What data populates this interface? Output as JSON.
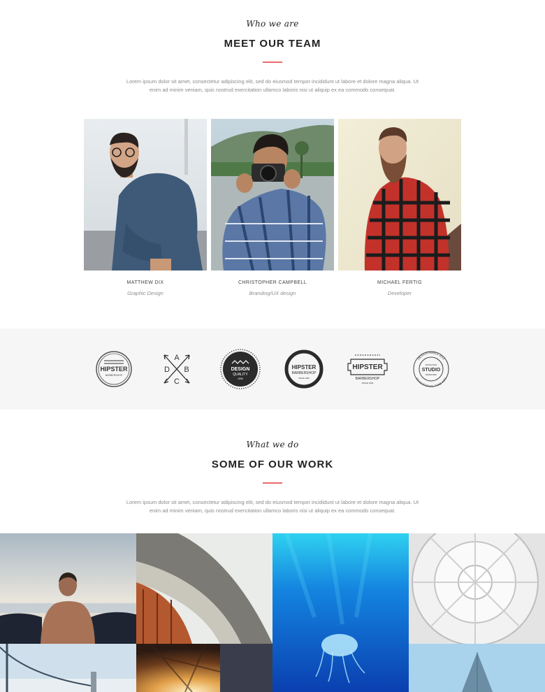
{
  "team": {
    "subtitle": "Who we are",
    "title": "MEET OUR TEAM",
    "text": "Lorem ipsum dolor sit amet, consectetur adipiscing elit, sed do eiusmod tempor incididunt ut labore et dolore magna aliqua. Ut enim ad minim veniam, quis nostrud exercitation ullamco laboris nisi ut aliquip ex ea commodo consequat.",
    "members": [
      {
        "name": "MATTHEW DIX",
        "role": "Graphic Design"
      },
      {
        "name": "CHRISTOPHER CAMPBELL",
        "role": "Branding/UX design"
      },
      {
        "name": "MICHAEL FERTIG",
        "role": "Developer"
      }
    ]
  },
  "logos": {
    "items": [
      {
        "icon": "hipster-barbershop-badge",
        "line1": "HIPSTER",
        "line2": "BARBERSHOP"
      },
      {
        "icon": "crossed-arrows-abcd",
        "a": "A",
        "b": "B",
        "c": "C",
        "d": "D"
      },
      {
        "icon": "design-quality-seal",
        "line1": "DESIGN",
        "line2": "QUALITY",
        "line3": "1990"
      },
      {
        "icon": "hipster-barbershop-round",
        "line1": "HIPSTER",
        "line2": "BARBERSHOP",
        "line3": "SINCE 1990"
      },
      {
        "icon": "hipster-barbershop-banner",
        "line1": "HIPSTER",
        "line2": "BARBERSHOP",
        "line3": "SINCE 1994"
      },
      {
        "icon": "design-studio-circle",
        "ring_top": "DESIGNTHINGS 2015",
        "line1": "SINCE 2010",
        "line2": "STUDIO",
        "line3": "DESIGNER",
        "ring_bottom": "TRADITIONAL FINE ART"
      }
    ]
  },
  "work": {
    "subtitle": "What we do",
    "title": "SOME OF OUR WORK",
    "text": "Lorem ipsum dolor sit amet, consectetur adipiscing elit, sed do eiusmod tempor incididunt ut labore et dolore magna aliqua. Ut enim ad minim veniam, quis nostrud exercitation ullamco laboris nisi ut aliquip ex ea commodo consequat."
  },
  "colors": {
    "accent": "#e96b6b",
    "band": "#f6f6f6",
    "heading": "#222222",
    "text": "#8a8a8a"
  }
}
